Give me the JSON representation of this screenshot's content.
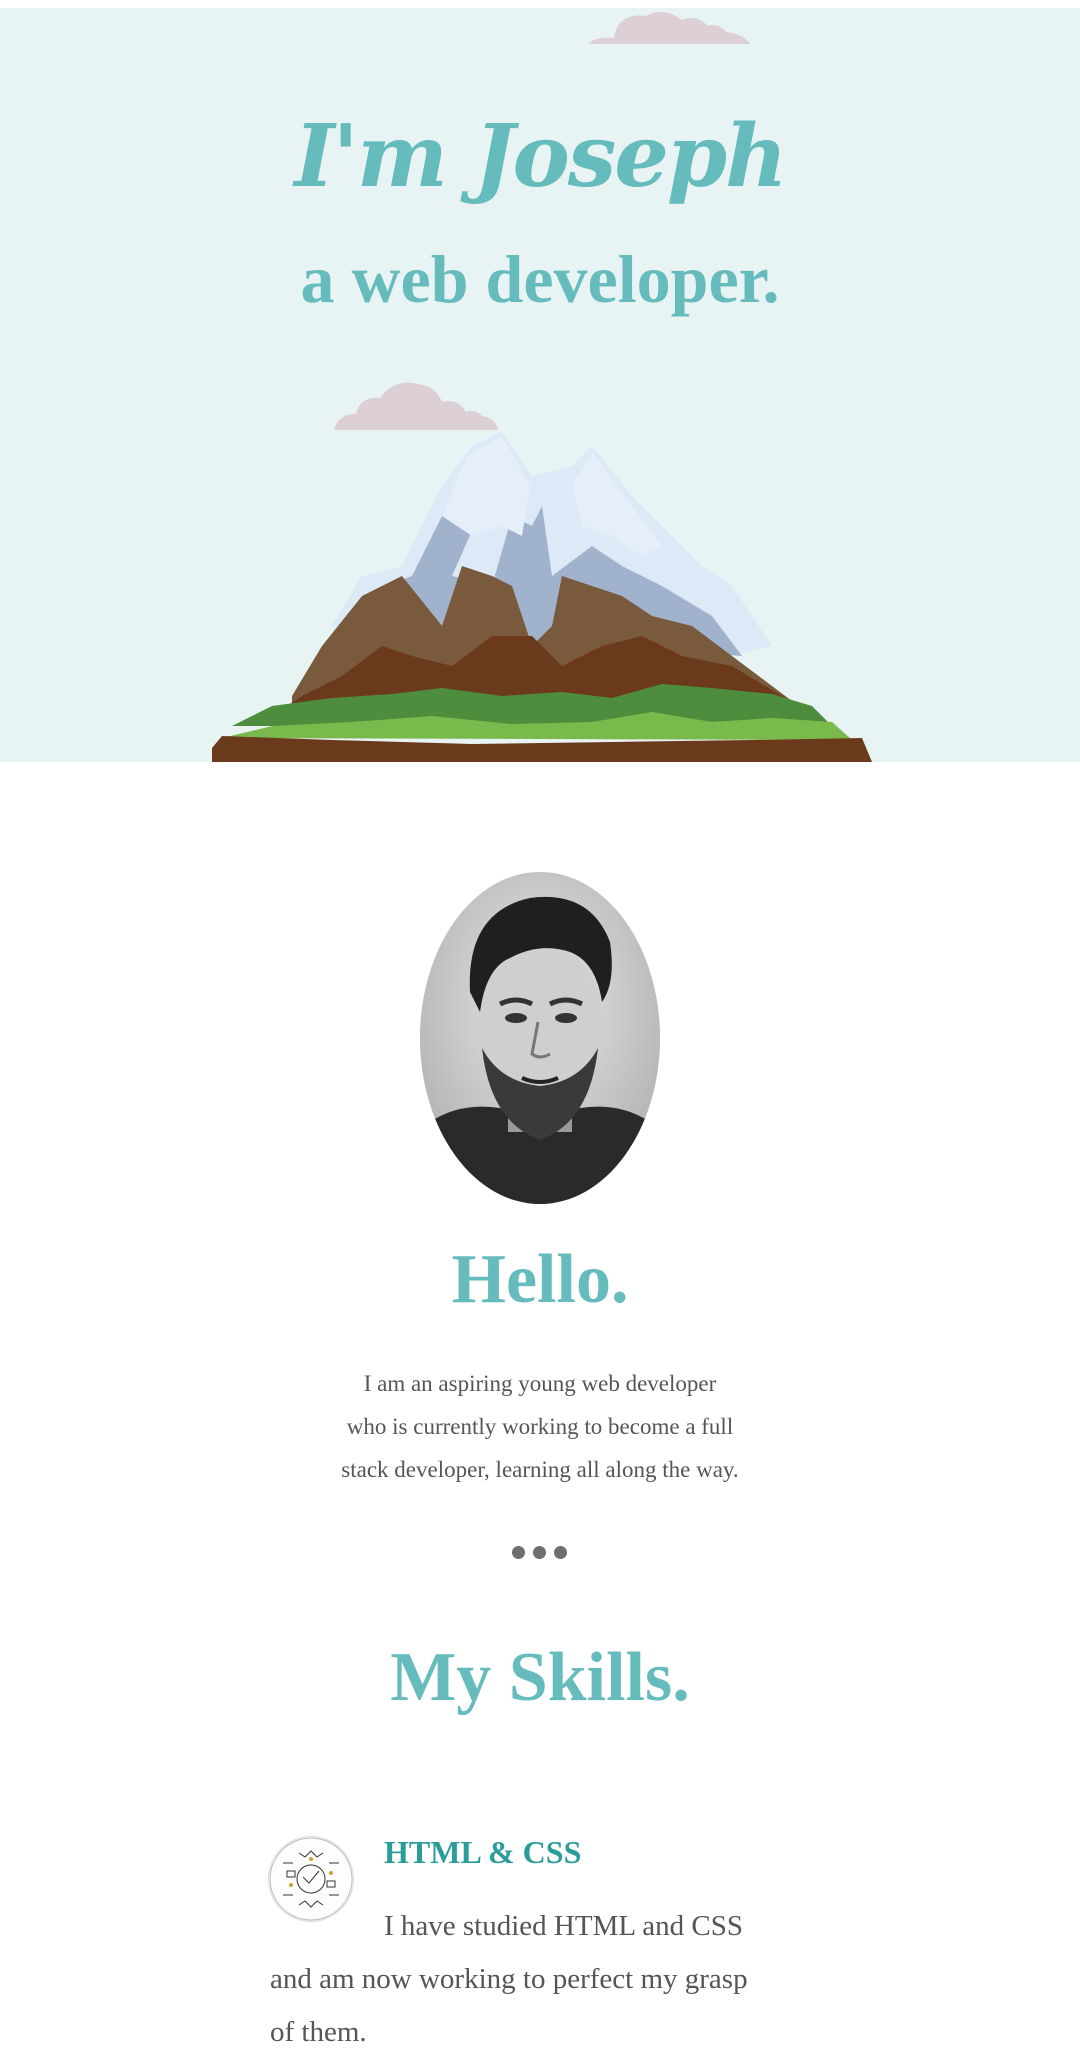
{
  "hero": {
    "name": "I'm Joseph",
    "subtitle": "a web developer."
  },
  "about": {
    "heading": "Hello.",
    "intro_lines": [
      "I am an aspiring young web developer",
      "who is currently working to become a full",
      "stack developer, learning all along the way."
    ]
  },
  "skills": {
    "heading": "My Skills.",
    "items": [
      {
        "title": "HTML & CSS",
        "desc_lines": [
          "I have studied HTML and CSS",
          "and am now working to perfect my grasp",
          "of them."
        ]
      }
    ]
  },
  "colors": {
    "accent": "#66bcbd",
    "hero_bg": "#e8f4f3",
    "cloud": "#dccfd6",
    "body_text": "#555555"
  },
  "icons": {
    "clouds": "cloud-icon",
    "mountain": "mountain-illustration",
    "separator": "dots-separator-icon"
  }
}
